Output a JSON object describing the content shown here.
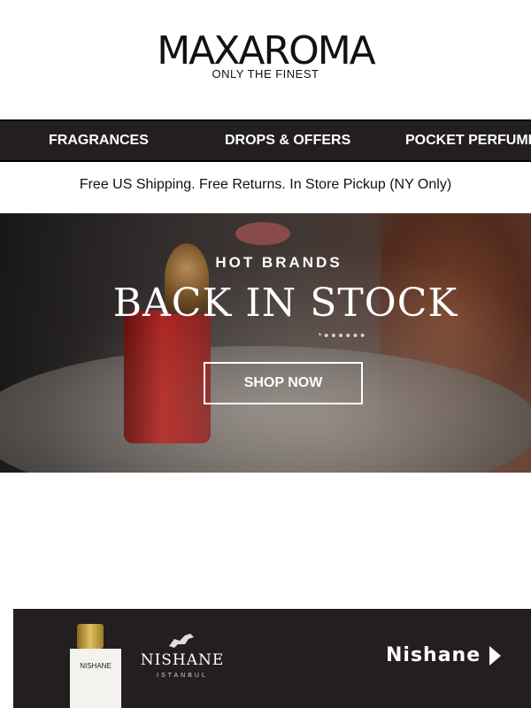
{
  "header": {
    "logo": "MAXAROMA",
    "tagline": "ONLY THE FINEST"
  },
  "nav": {
    "items": [
      "FRAGRANCES",
      "DROPS & OFFERS",
      "POCKET PERFUMES"
    ]
  },
  "shipping_text": "Free US Shipping. Free Returns. In Store Pickup (NY Only)",
  "hero": {
    "eyebrow": "HOT BRANDS",
    "title": "BACK IN STOCK",
    "cta": "SHOP NOW"
  },
  "brand_card": {
    "product_label": "NISHANE",
    "logo": "NISHANE",
    "city": "ISTANBUL",
    "link": "Nishane",
    "icon": "chevron-right-icon"
  },
  "colors": {
    "nav_background": "#231f20",
    "card_background": "#231f20",
    "text_primary": "#111111",
    "on_dark": "#ffffff"
  }
}
